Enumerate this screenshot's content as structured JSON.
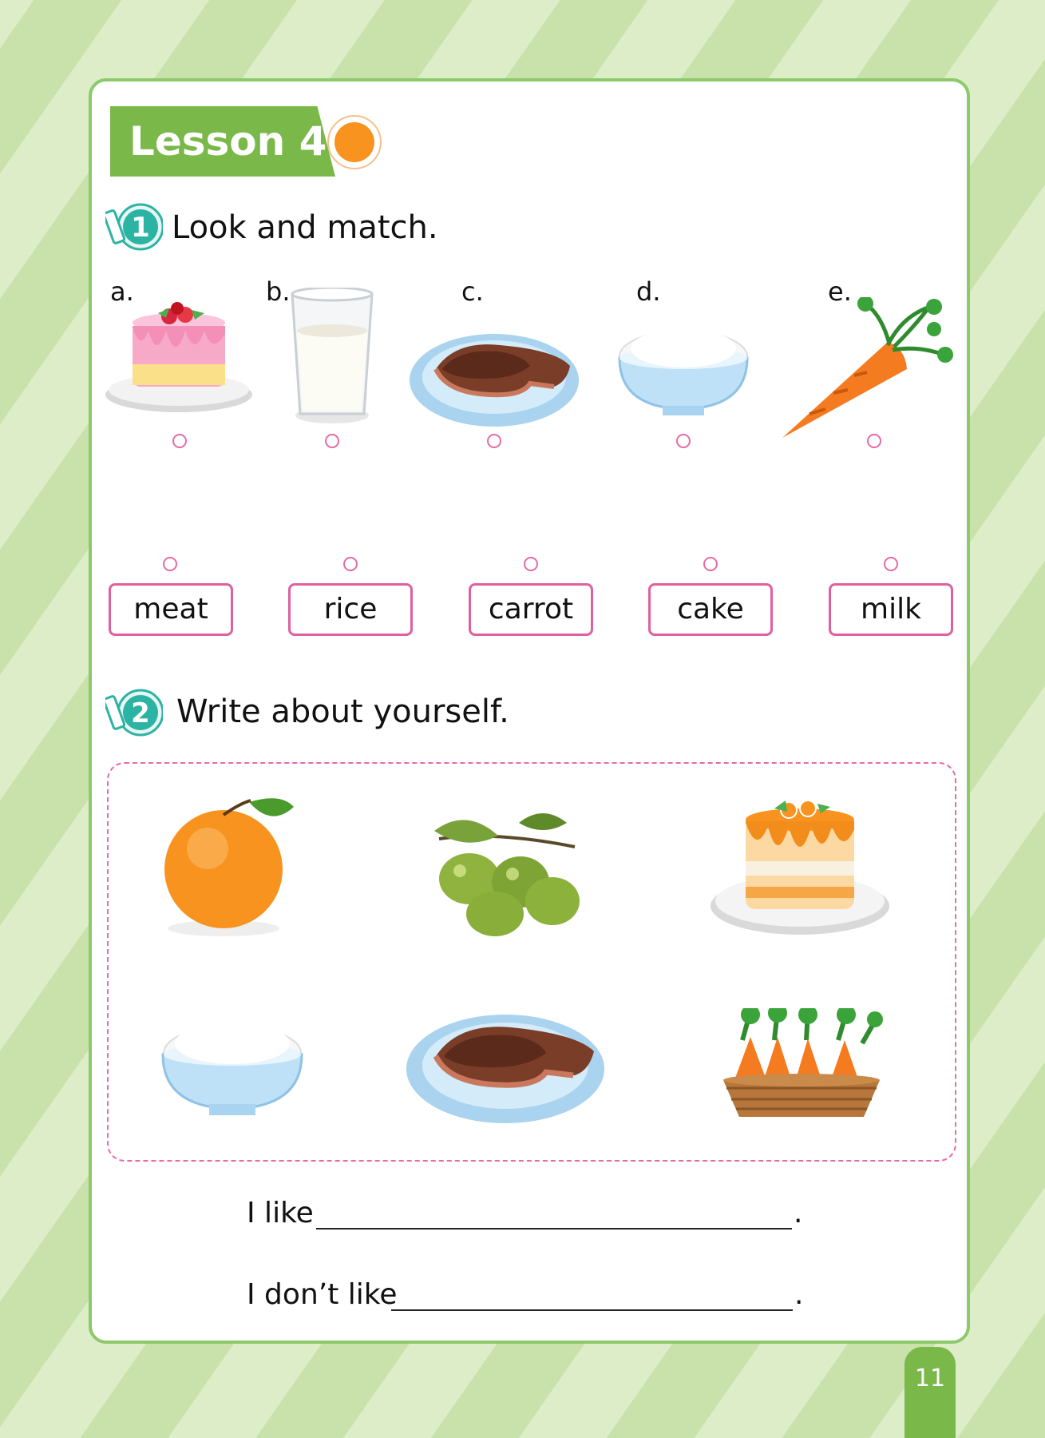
{
  "lesson": {
    "title": "Lesson 4"
  },
  "exercise1": {
    "number": "1",
    "instruction": "Look and match.",
    "picture_letters": [
      "a.",
      "b.",
      "c.",
      "d.",
      "e."
    ],
    "words": [
      "meat",
      "rice",
      "carrot",
      "cake",
      "milk"
    ]
  },
  "exercise2": {
    "number": "2",
    "instruction": "Write about yourself.",
    "pictures": [
      "orange-icon",
      "olives-icon",
      "orange-cake-icon",
      "rice-bowl-icon",
      "meat-plate-icon",
      "carrot-basket-icon"
    ],
    "sentence_like": "I like",
    "sentence_dont_like": "I don’t like",
    "period": "."
  },
  "page_number": "11",
  "colors": {
    "green": "#7ab84a",
    "pink": "#e0609e",
    "teal": "#2bb3a3",
    "orange": "#f7931e"
  }
}
